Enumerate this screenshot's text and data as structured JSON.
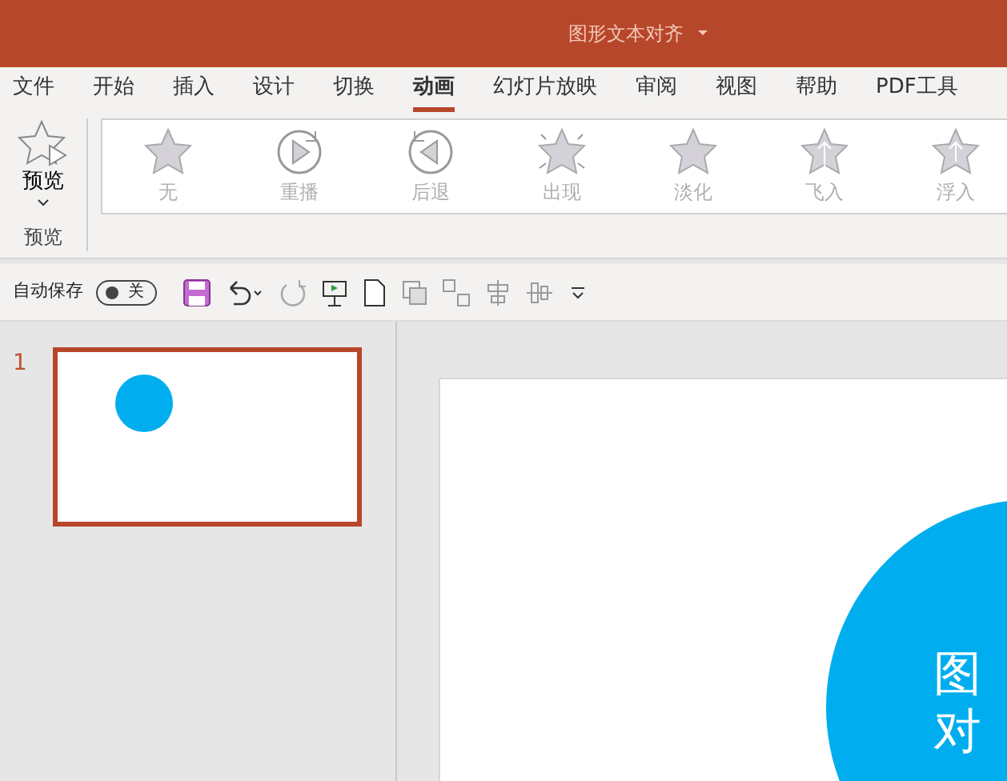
{
  "window": {
    "title": "图形文本对齐"
  },
  "tabs": [
    {
      "label": "文件",
      "selected": false
    },
    {
      "label": "开始",
      "selected": false
    },
    {
      "label": "插入",
      "selected": false
    },
    {
      "label": "设计",
      "selected": false
    },
    {
      "label": "切换",
      "selected": false
    },
    {
      "label": "动画",
      "selected": true
    },
    {
      "label": "幻灯片放映",
      "selected": false
    },
    {
      "label": "审阅",
      "selected": false
    },
    {
      "label": "视图",
      "selected": false
    },
    {
      "label": "帮助",
      "selected": false
    },
    {
      "label": "PDF工具",
      "selected": false
    }
  ],
  "preview": {
    "label": "预览",
    "group_label": "预览"
  },
  "animations": [
    {
      "label": "无",
      "kind": "none"
    },
    {
      "label": "重播",
      "kind": "replay"
    },
    {
      "label": "后退",
      "kind": "back"
    },
    {
      "label": "出现",
      "kind": "appear"
    },
    {
      "label": "淡化",
      "kind": "fade"
    },
    {
      "label": "飞入",
      "kind": "fly"
    },
    {
      "label": "浮入",
      "kind": "float"
    }
  ],
  "quick_access": {
    "autosave_label": "自动保存",
    "autosave": {
      "on": false,
      "label": "关"
    }
  },
  "slides": [
    {
      "number": "1",
      "selected": true
    }
  ],
  "slide": {
    "lines": [
      "图",
      "对"
    ]
  }
}
